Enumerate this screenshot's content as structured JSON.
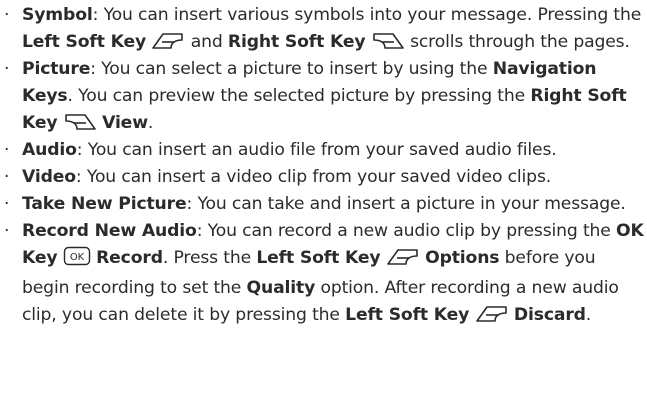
{
  "bullet": "·",
  "items": [
    {
      "term": "Symbol",
      "t1": ": You can insert various symbols into your message. Pressing the ",
      "k1": "Left Soft Key",
      "t2": " and ",
      "k2": "Right Soft Key",
      "t3": " scrolls through the pages."
    },
    {
      "term": "Picture",
      "t1": ": You can select a picture to insert by using the ",
      "k1": "Navigation Keys",
      "t2": ". You can preview the selected picture by pressing the ",
      "k2": "Right Soft Key",
      "k3": "View",
      "t3": "."
    },
    {
      "term": "Audio",
      "t1": ": You can insert an audio file from your saved audio files."
    },
    {
      "term": "Video",
      "t1": ": You can insert a video clip from your saved video clips."
    },
    {
      "term": "Take New Picture",
      "t1": ": You can take and insert a picture in your message."
    },
    {
      "term": "Record New Audio",
      "t1": ": You can record a new audio clip by pressing the ",
      "k1": "OK Key",
      "ok_glyph": "OK",
      "k2": "Record",
      "t2": ". Press the ",
      "k3": "Left Soft Key",
      "k4": "Options",
      "t3": " before you begin recording to set the ",
      "k5": "Quality",
      "t4": " option. After recording a new audio clip, you can delete it by pressing the ",
      "k6": "Left Soft Key",
      "k7": "Discard",
      "t5": "."
    }
  ],
  "icons": {
    "left_soft_key": "left-soft-key-icon",
    "right_soft_key": "right-soft-key-icon",
    "ok_key": "ok-key-icon"
  }
}
